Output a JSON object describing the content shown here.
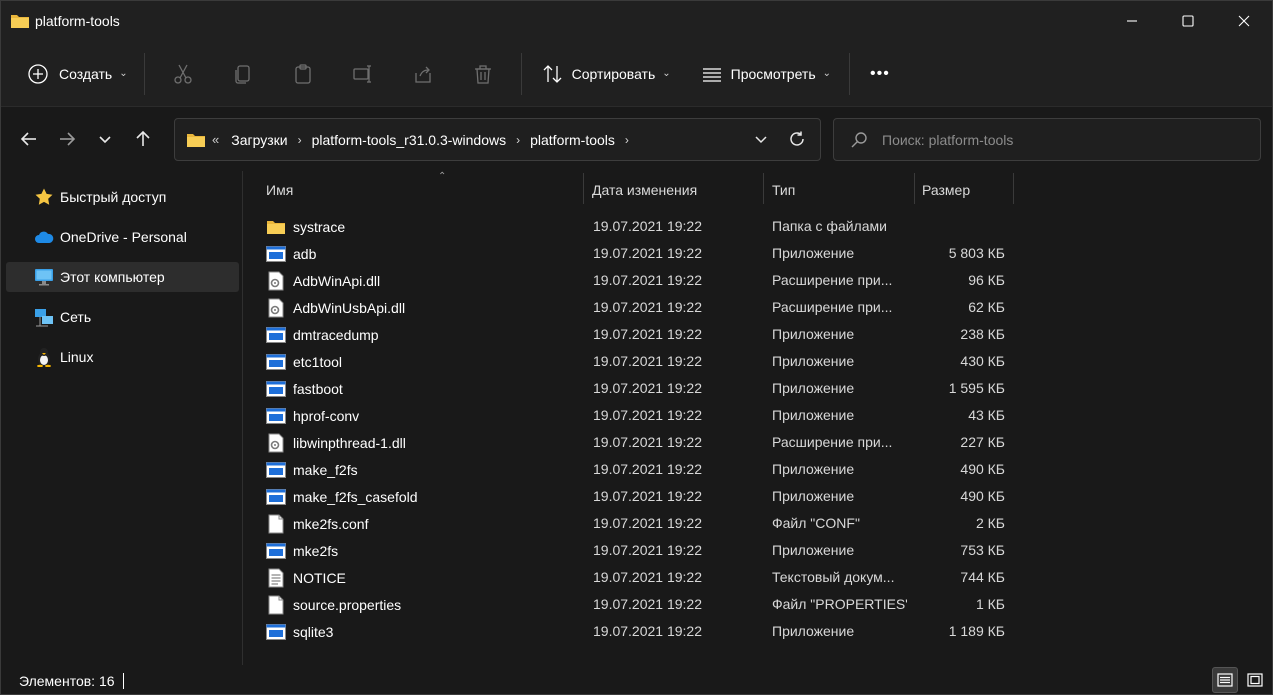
{
  "window": {
    "title": "platform-tools",
    "icon": "folder-icon",
    "controls": [
      "minimize-icon",
      "maximize-icon",
      "close-icon"
    ]
  },
  "commandbar": {
    "new_label": "Создать",
    "sort_label": "Сортировать",
    "view_label": "Просмотреть",
    "more_label": "•••"
  },
  "address": {
    "overflow": "«",
    "crumbs": [
      "Загрузки",
      "platform-tools_r31.0.3-windows",
      "platform-tools"
    ]
  },
  "search": {
    "placeholder": "Поиск: platform-tools"
  },
  "sidebar": {
    "items": [
      {
        "label": "Быстрый доступ",
        "icon": "star-icon"
      },
      {
        "label": "OneDrive - Personal",
        "icon": "cloud-icon"
      },
      {
        "label": "Этот компьютер",
        "icon": "monitor-icon",
        "selected": true
      },
      {
        "label": "Сеть",
        "icon": "network-icon"
      },
      {
        "label": "Linux",
        "icon": "penguin-icon"
      }
    ]
  },
  "columns": {
    "name": "Имя",
    "date": "Дата изменения",
    "type": "Тип",
    "size": "Размер"
  },
  "files": [
    {
      "name": "systrace",
      "date": "19.07.2021 19:22",
      "type": "Папка с файлами",
      "size": "",
      "icon": "folder-icon"
    },
    {
      "name": "adb",
      "date": "19.07.2021 19:22",
      "type": "Приложение",
      "size": "5 803 КБ",
      "icon": "app-icon"
    },
    {
      "name": "AdbWinApi.dll",
      "date": "19.07.2021 19:22",
      "type": "Расширение при...",
      "size": "96 КБ",
      "icon": "dll-icon"
    },
    {
      "name": "AdbWinUsbApi.dll",
      "date": "19.07.2021 19:22",
      "type": "Расширение при...",
      "size": "62 КБ",
      "icon": "dll-icon"
    },
    {
      "name": "dmtracedump",
      "date": "19.07.2021 19:22",
      "type": "Приложение",
      "size": "238 КБ",
      "icon": "app-icon"
    },
    {
      "name": "etc1tool",
      "date": "19.07.2021 19:22",
      "type": "Приложение",
      "size": "430 КБ",
      "icon": "app-icon"
    },
    {
      "name": "fastboot",
      "date": "19.07.2021 19:22",
      "type": "Приложение",
      "size": "1 595 КБ",
      "icon": "app-icon"
    },
    {
      "name": "hprof-conv",
      "date": "19.07.2021 19:22",
      "type": "Приложение",
      "size": "43 КБ",
      "icon": "app-icon"
    },
    {
      "name": "libwinpthread-1.dll",
      "date": "19.07.2021 19:22",
      "type": "Расширение при...",
      "size": "227 КБ",
      "icon": "dll-icon"
    },
    {
      "name": "make_f2fs",
      "date": "19.07.2021 19:22",
      "type": "Приложение",
      "size": "490 КБ",
      "icon": "app-icon"
    },
    {
      "name": "make_f2fs_casefold",
      "date": "19.07.2021 19:22",
      "type": "Приложение",
      "size": "490 КБ",
      "icon": "app-icon"
    },
    {
      "name": "mke2fs.conf",
      "date": "19.07.2021 19:22",
      "type": "Файл \"CONF\"",
      "size": "2 КБ",
      "icon": "blank-file-icon"
    },
    {
      "name": "mke2fs",
      "date": "19.07.2021 19:22",
      "type": "Приложение",
      "size": "753 КБ",
      "icon": "app-icon"
    },
    {
      "name": "NOTICE",
      "date": "19.07.2021 19:22",
      "type": "Текстовый докум...",
      "size": "744 КБ",
      "icon": "text-file-icon"
    },
    {
      "name": "source.properties",
      "date": "19.07.2021 19:22",
      "type": "Файл \"PROPERTIES\"",
      "size": "1 КБ",
      "icon": "blank-file-icon"
    },
    {
      "name": "sqlite3",
      "date": "19.07.2021 19:22",
      "type": "Приложение",
      "size": "1 189 КБ",
      "icon": "app-icon"
    }
  ],
  "status": {
    "count_text": "Элементов: 16"
  },
  "colors": {
    "folder": "#f4c542",
    "background": "#191919",
    "chrome": "#202020",
    "app_icon_blue": "#1e6fd9"
  }
}
